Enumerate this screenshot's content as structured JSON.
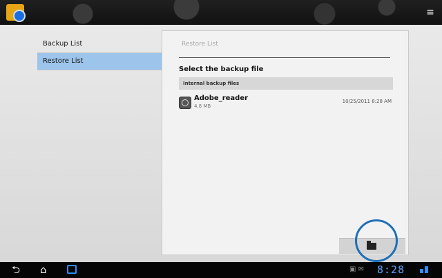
{
  "left_nav": {
    "items": [
      {
        "label": "Backup List"
      },
      {
        "label": "Restore List"
      }
    ]
  },
  "panel": {
    "tab_label": "Restore List",
    "title": "Select the backup file",
    "section_header": "Internal backup files",
    "files": [
      {
        "name": "Adobe_reader",
        "size": "4.8 MB",
        "date": "10/25/2011 8:28 AM"
      }
    ]
  },
  "status_bar": {
    "time": "8:28"
  },
  "icons": {
    "app": "app-backup-icon",
    "menu": "menu-icon",
    "back": "back-icon",
    "home": "home-icon",
    "recent": "recent-apps-icon",
    "folder": "folder-search-icon"
  },
  "colors": {
    "selected_nav": "#9dc4ea",
    "accent": "#1f6fb5"
  }
}
